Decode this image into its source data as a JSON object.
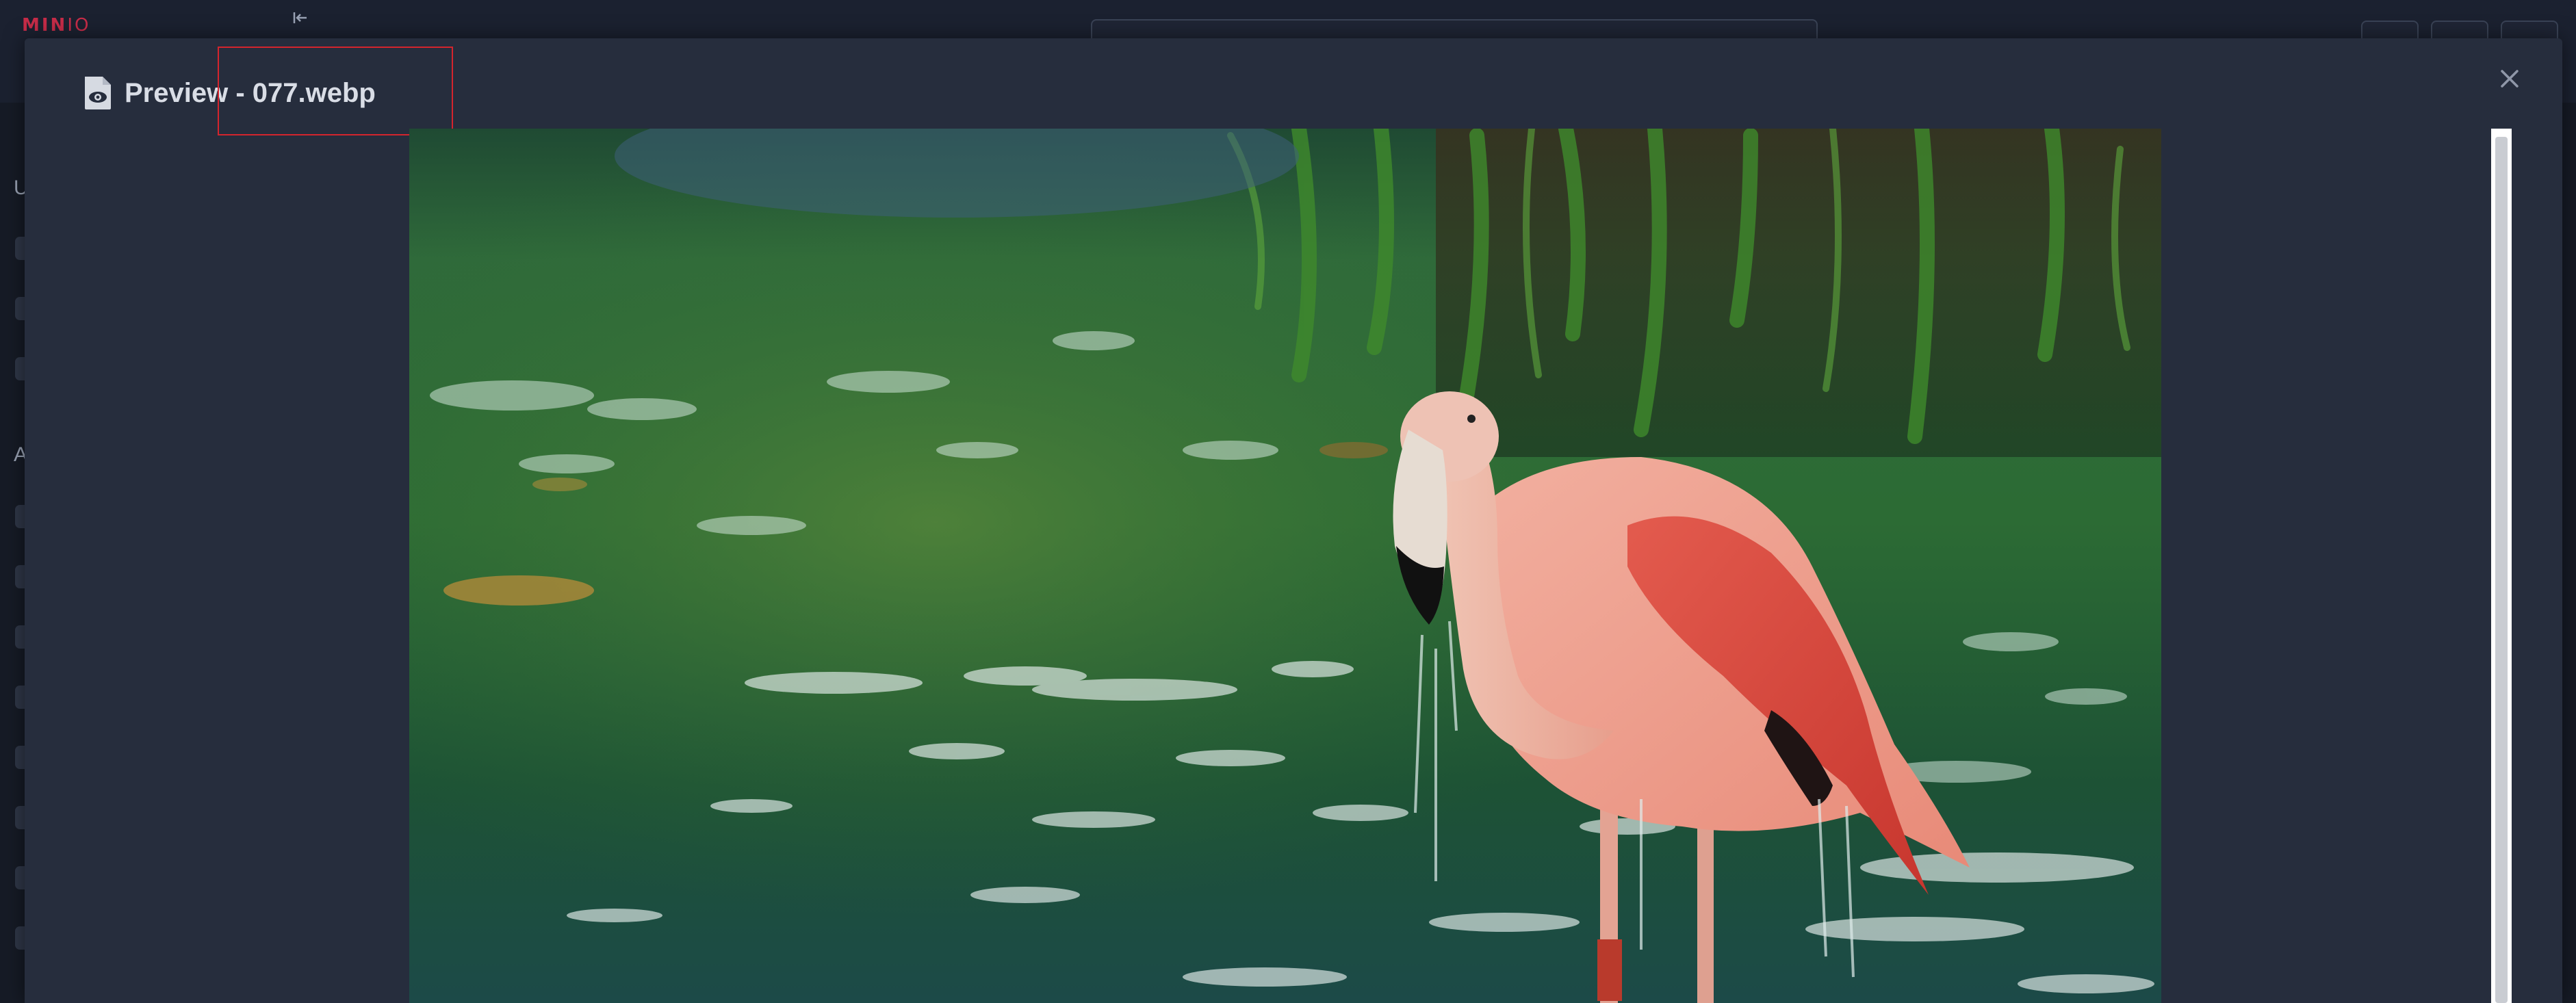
{
  "app": {
    "logo_text": "MIN",
    "logo_suffix": "IO",
    "sidebar_section_letters": [
      "U",
      "A"
    ]
  },
  "modal": {
    "title": "Preview - 077.webp",
    "icon": "preview-eye-icon",
    "close_icon": "close-icon"
  },
  "preview": {
    "subject": "flamingo-image"
  },
  "colors": {
    "accent": "#c72c48",
    "modal_bg": "#262d3d",
    "highlight": "#d4242d"
  }
}
